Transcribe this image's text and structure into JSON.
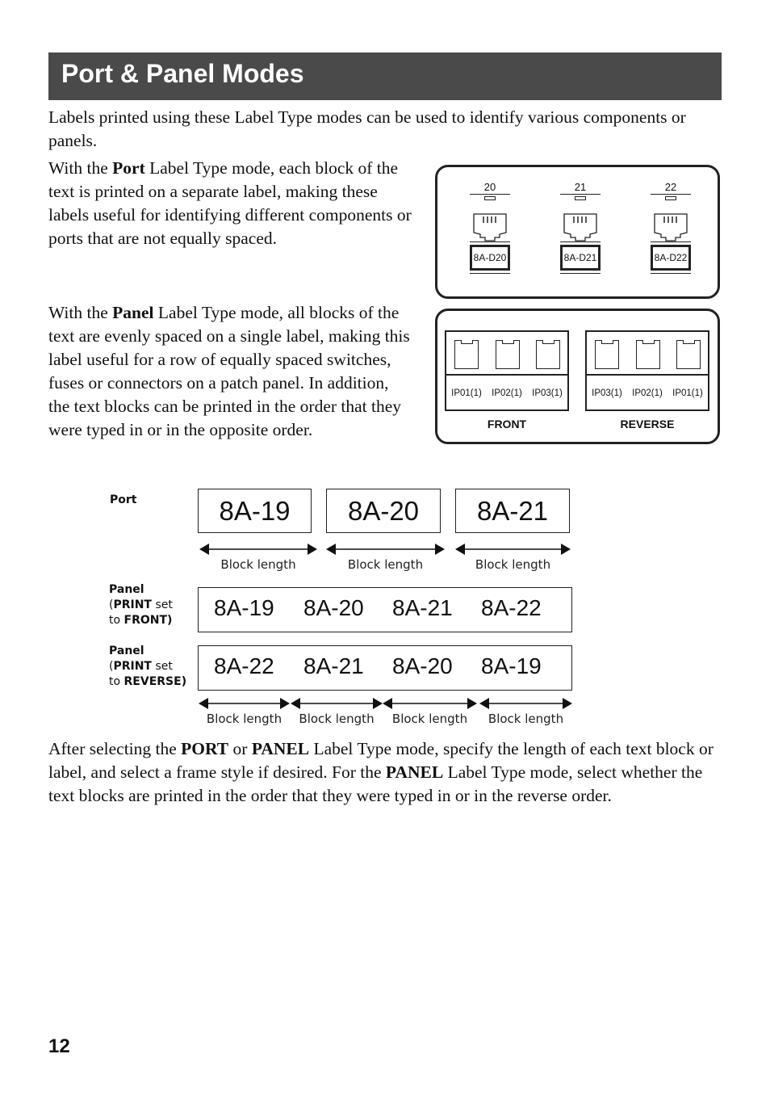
{
  "header": {
    "title": "Port & Panel Modes"
  },
  "intro": "Labels printed using these Label Type modes can be used to identify various components or panels.",
  "port_paragraph": {
    "pre": "With the ",
    "bold": "Port",
    "post": " Label Type mode, each block of the text is printed on a separate label, making these labels useful for identifying different components or ports that are not equally spaced."
  },
  "panel_paragraph": {
    "pre": "With the ",
    "bold": "Panel",
    "post": " Label Type mode, all blocks of the text are evenly spaced on a single label, making this label useful for a row of equally spaced switches, fuses or connectors on a patch panel. In addition, the text blocks can be printed in the order that they were typed in or in the opposite order."
  },
  "port_illustration": {
    "ports": [
      {
        "number": "20",
        "label": "8A-D20"
      },
      {
        "number": "21",
        "label": "8A-D21"
      },
      {
        "number": "22",
        "label": "8A-D22"
      }
    ]
  },
  "panel_illustration": {
    "front": {
      "caption": "FRONT",
      "labels": [
        "IP01(1)",
        "IP02(1)",
        "IP03(1)"
      ]
    },
    "reverse": {
      "caption": "REVERSE",
      "labels": [
        "IP03(1)",
        "IP02(1)",
        "IP01(1)"
      ]
    }
  },
  "examples": {
    "port": {
      "label": "Port",
      "blocks": [
        "8A-19",
        "8A-20",
        "8A-21"
      ],
      "block_length_label": "Block length"
    },
    "panel_front": {
      "label_line1": "Panel",
      "label_print": "PRINT",
      "label_set": " set",
      "label_to": "to ",
      "label_mode": "FRONT",
      "label_close": ")",
      "blocks": [
        "8A-19",
        "8A-20",
        "8A-21",
        "8A-22"
      ]
    },
    "panel_reverse": {
      "label_line1": "Panel",
      "label_print": "PRINT",
      "label_set": " set",
      "label_to": "to ",
      "label_mode": "REVERSE",
      "label_close": ")",
      "blocks": [
        "8A-22",
        "8A-21",
        "8A-20",
        "8A-19"
      ],
      "block_length_label": "Block length"
    }
  },
  "closing_paragraph": {
    "t1": "After selecting the ",
    "b1": "PORT",
    "t2": " or ",
    "b2": "PANEL",
    "t3": " Label Type mode, specify the length of each text block or label, and select a frame style if desired. For the ",
    "b3": "PANEL",
    "t4": " Label Type mode, select whether the text blocks are printed in the order that they were typed in or in the reverse order."
  },
  "page_number": "12"
}
